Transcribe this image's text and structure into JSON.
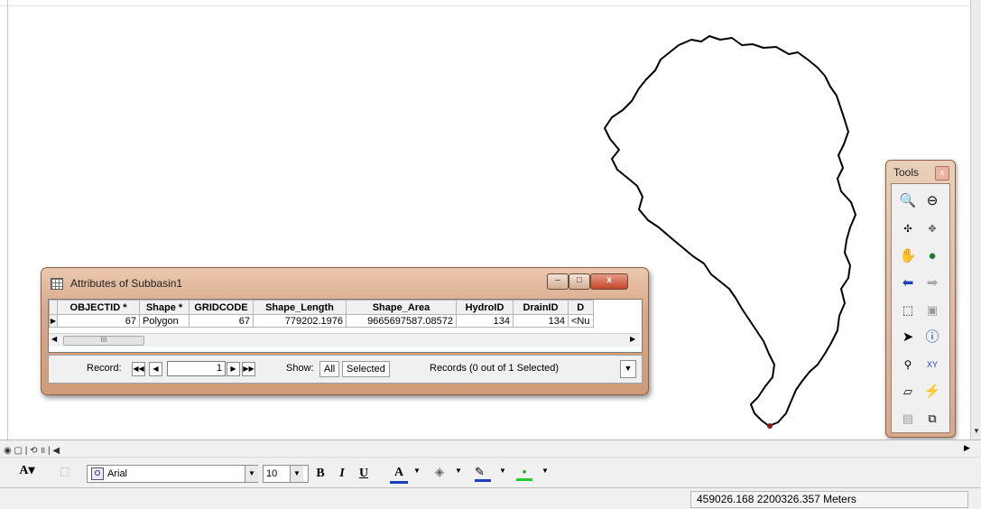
{
  "attr_window": {
    "title": "Attributes of Subbasin1",
    "minimize": "–",
    "maximize": "□",
    "close": "x",
    "columns": [
      "OBJECTID *",
      "Shape *",
      "GRIDCODE",
      "Shape_Length",
      "Shape_Area",
      "HydroID",
      "DrainID",
      "D"
    ],
    "row": [
      "67",
      "Polygon",
      "67",
      "779202.1976",
      "9665697587.08572",
      "134",
      "134",
      "<Nu"
    ],
    "scroll_thumb": "III",
    "record_label": "Record:",
    "record_value": "1",
    "nav_first": "◀◀",
    "nav_prev": "◀",
    "nav_next": "▶",
    "nav_last": "▶▶",
    "show_label": "Show:",
    "show_all": "All",
    "show_selected": "Selected",
    "records_text": "Records (0 out of 1 Selected)"
  },
  "tools": {
    "title": "Tools",
    "close": "x",
    "icons": [
      "zoom-in-icon",
      "zoom-out-icon",
      "fixed-zoom-in-icon",
      "fixed-zoom-out-icon",
      "pan-icon",
      "full-extent-icon",
      "back-extent-icon",
      "forward-extent-icon",
      "select-features-icon",
      "clear-selection-icon",
      "select-elements-icon",
      "identify-icon",
      "find-icon",
      "go-to-xy-icon",
      "measure-icon",
      "hyperlink-icon",
      "html-popup-icon",
      "time-slider-icon"
    ]
  },
  "drawing_toolbar": {
    "font_name": "Arial",
    "font_size": "10",
    "bold": "B",
    "italic": "I",
    "underline": "U",
    "font_color": "A"
  },
  "status": {
    "coordinates": "459026.168  2200326.357 Meters"
  },
  "colors": {
    "window_frame": "#d9a888",
    "basin_outline": "#000000"
  }
}
